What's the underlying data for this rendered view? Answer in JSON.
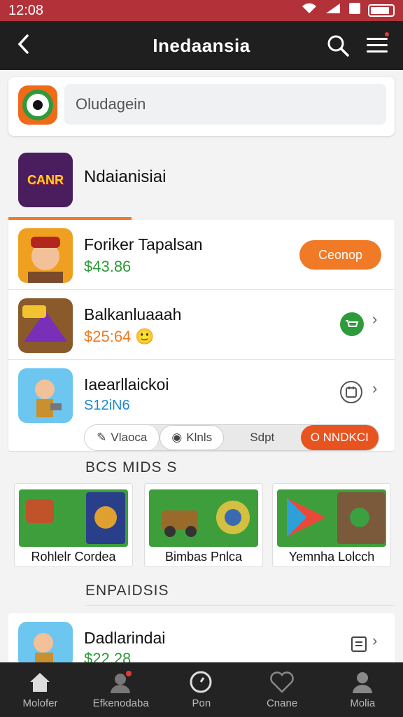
{
  "status_bar": {
    "time": "12:08"
  },
  "header": {
    "title": "Inedaansia"
  },
  "search": {
    "placeholder": "Oludagein"
  },
  "featured": {
    "icon_text": "CANR",
    "title": "Ndaianisiai"
  },
  "list": [
    {
      "name": "Foriker Tapalsan",
      "price": "$43.86",
      "action_label": "Ceonop"
    },
    {
      "name": "Balkanluaaah",
      "price": "$25:64",
      "emoji": "🙂"
    },
    {
      "name": "Iaearllaickoi",
      "price": "S12iN6"
    }
  ],
  "segments": [
    "Vlaoca",
    "Klnls",
    "Sdpt",
    "O NNDKCI"
  ],
  "section1": {
    "heading": "BCS MIDS S"
  },
  "tiles": [
    {
      "caption": "Rohlelr Cordea"
    },
    {
      "caption": "Bimbas Pnlca"
    },
    {
      "caption": "Yemnha Lolcch"
    }
  ],
  "section2": {
    "heading": "ENPAIDSIS"
  },
  "bottom_item": {
    "name": "Dadlarindai",
    "price": "$22.28"
  },
  "nav": [
    "Molofer",
    "Efkenodaba",
    "Pon",
    "Cnane",
    "Molia"
  ],
  "colors": {
    "status": "#b3323a",
    "accent": "#f07a25",
    "green": "#2e9b3a",
    "appbar": "#1f1f1f"
  }
}
